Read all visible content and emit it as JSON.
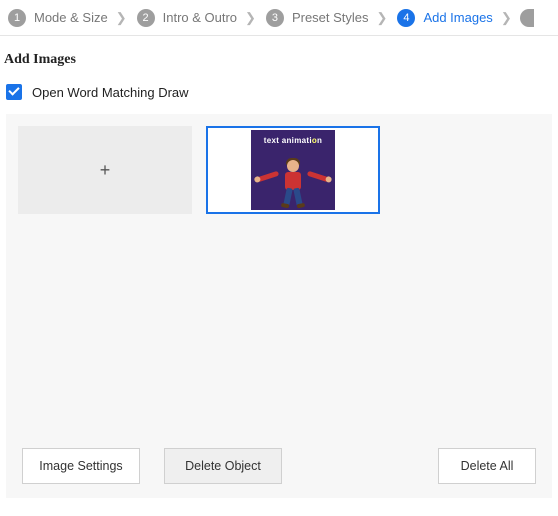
{
  "wizard": {
    "steps": [
      {
        "num": "1",
        "label": "Mode & Size"
      },
      {
        "num": "2",
        "label": "Intro & Outro"
      },
      {
        "num": "3",
        "label": "Preset Styles"
      },
      {
        "num": "4",
        "label": "Add Images"
      }
    ],
    "active_index": 3
  },
  "section_title": "Add Images",
  "checkbox": {
    "label": "Open Word Matching Draw",
    "checked": true
  },
  "thumbs": {
    "add_glyph": "+",
    "items": [
      {
        "caption_a": "text animati",
        "caption_b": "o",
        "caption_c": "n"
      }
    ]
  },
  "buttons": {
    "image_settings": "Image Settings",
    "delete_object": "Delete Object",
    "delete_all": "Delete All"
  }
}
